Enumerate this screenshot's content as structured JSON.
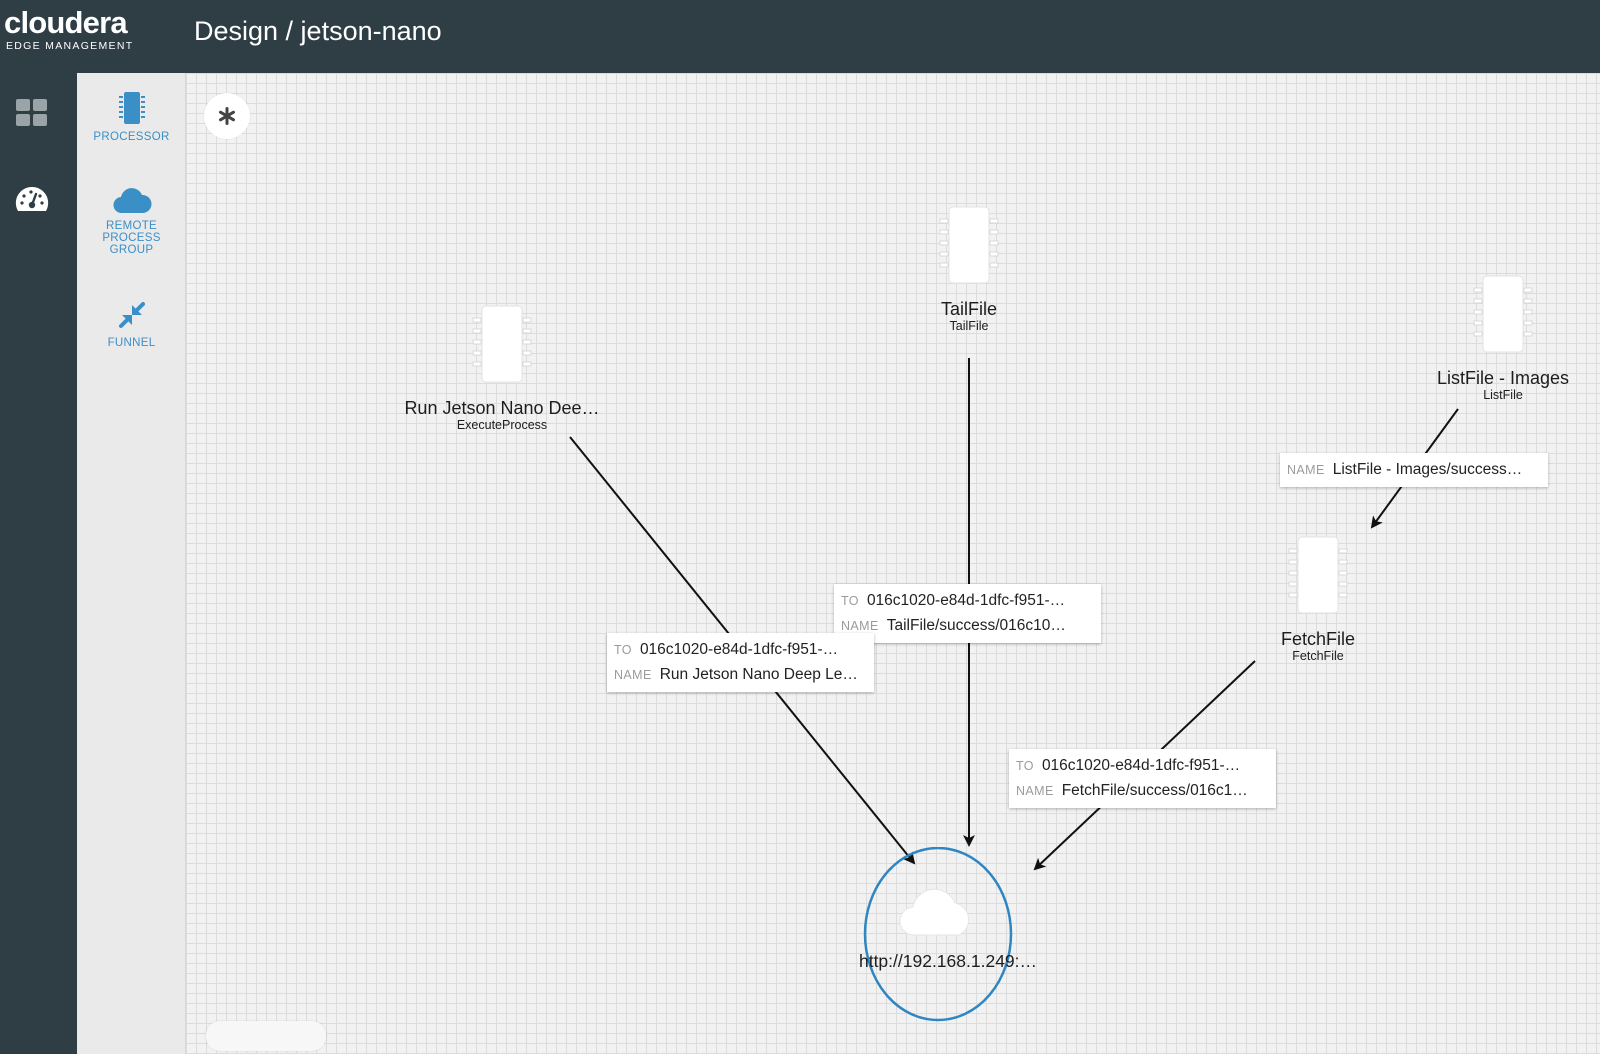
{
  "header": {
    "logo_word": "cloudera",
    "logo_sub": "EDGE MANAGEMENT",
    "title": "Design / jetson-nano"
  },
  "nav": {
    "items": [
      {
        "icon": "dashboard-grid-icon"
      },
      {
        "icon": "speedometer-icon"
      }
    ]
  },
  "palette": {
    "processor_label": "PROCESSOR",
    "remote_process_group_label": "REMOTE\nPROCESS\nGROUP",
    "funnel_label": "FUNNEL"
  },
  "canvas": {
    "processors": [
      {
        "name": "TailFile",
        "type": "TailFile"
      },
      {
        "name": "Run Jetson Nano Dee…",
        "type": "ExecuteProcess"
      },
      {
        "name": "ListFile - Images",
        "type": "ListFile"
      },
      {
        "name": "FetchFile",
        "type": "FetchFile"
      }
    ],
    "connections": [
      {
        "to_key": "TO",
        "to": "016c1020-e84d-1dfc-f951-…",
        "name_key": "NAME",
        "name": "TailFile/success/016c10…"
      },
      {
        "to_key": "TO",
        "to": "016c1020-e84d-1dfc-f951-…",
        "name_key": "NAME",
        "name": "Run Jetson Nano Deep Le…"
      },
      {
        "name_key": "NAME",
        "name": "ListFile - Images/success…"
      },
      {
        "to_key": "TO",
        "to": "016c1020-e84d-1dfc-f951-…",
        "name_key": "NAME",
        "name": "FetchFile/success/016c1…"
      }
    ],
    "remote_process_group": {
      "url": "http://192.168.1.249:…"
    }
  },
  "colors": {
    "header_bg": "#2f3d45",
    "accent": "#3a8fc7",
    "canvas_bg": "#f2f2f2"
  }
}
